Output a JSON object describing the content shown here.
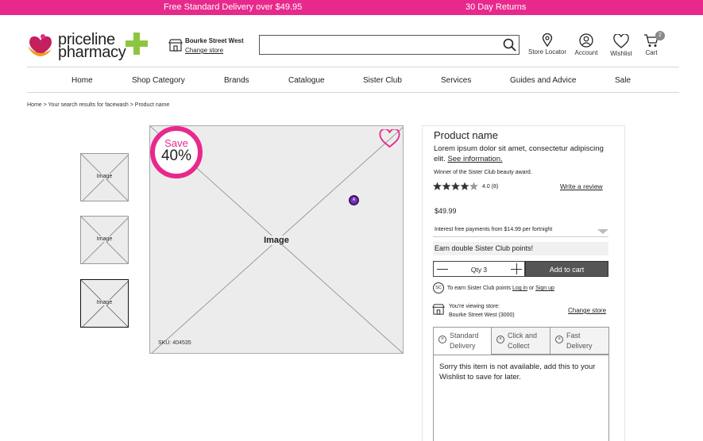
{
  "topbar": {
    "promo_delivery": "Free Standard Delivery over $49.95",
    "promo_returns": "30 Day Returns",
    "bg_color": "#e8298c"
  },
  "logo": {
    "line1": "priceline",
    "line2": "pharmacy",
    "icon_heart": "heart-logo-icon",
    "icon_cross": "green-cross-icon"
  },
  "store": {
    "name": "Bourke Street West",
    "change_label": "Change store"
  },
  "search": {
    "placeholder": "",
    "value": ""
  },
  "header_icons": {
    "store_locator": "Store Locator",
    "account": "Account",
    "wishlist": "Wishlist",
    "cart": "Cart",
    "cart_count": "2"
  },
  "nav": {
    "items": [
      "Home",
      "Shop Category",
      "Brands",
      "Catalogue",
      "Sister Club",
      "Services",
      "Guides and Advice",
      "Sale"
    ]
  },
  "breadcrumb": {
    "text": "Home > Your search results for facewash > Product name"
  },
  "gallery": {
    "thumbs": [
      "Image",
      "Image",
      "Image"
    ],
    "main_label": "Image",
    "sku": "SKU: 404535",
    "save_label": "Save",
    "save_percent": "40%",
    "pin_label": "A"
  },
  "product": {
    "name": "Product name",
    "desc": "Lorem ipsum dolor sit amet, consectetur adipiscing elit.",
    "see_info": "See information.",
    "award": "Winner of the Sister Club beauty award.",
    "rating_value": 4.0,
    "rating_text": "4.0 (8)",
    "write_review": "Write a review",
    "price": "$49.99",
    "finance": "Interest free payments from $14.99 per fortnight",
    "points_promo": "Earn double Sister Club points!",
    "qty_label": "Qty 3",
    "add_to_cart": "Add to cart",
    "sc_badge": "SC",
    "sc_prefix": "To earn Sister Club points",
    "sc_login": "Log in",
    "sc_or": "or",
    "sc_signup": "Sign up",
    "viewing_store_label": "You're viewing store:",
    "viewing_store_name": "Bourke Street West (3000)",
    "change_store": "Change store"
  },
  "delivery": {
    "tabs": [
      {
        "line1": "Standard",
        "line2": "Delivery"
      },
      {
        "line1": "Click and",
        "line2": "Collect"
      },
      {
        "line1": "Fast",
        "line2": "Delivery"
      }
    ],
    "message": "Sorry this item is not available, add this to your Wishlist to save for later."
  }
}
